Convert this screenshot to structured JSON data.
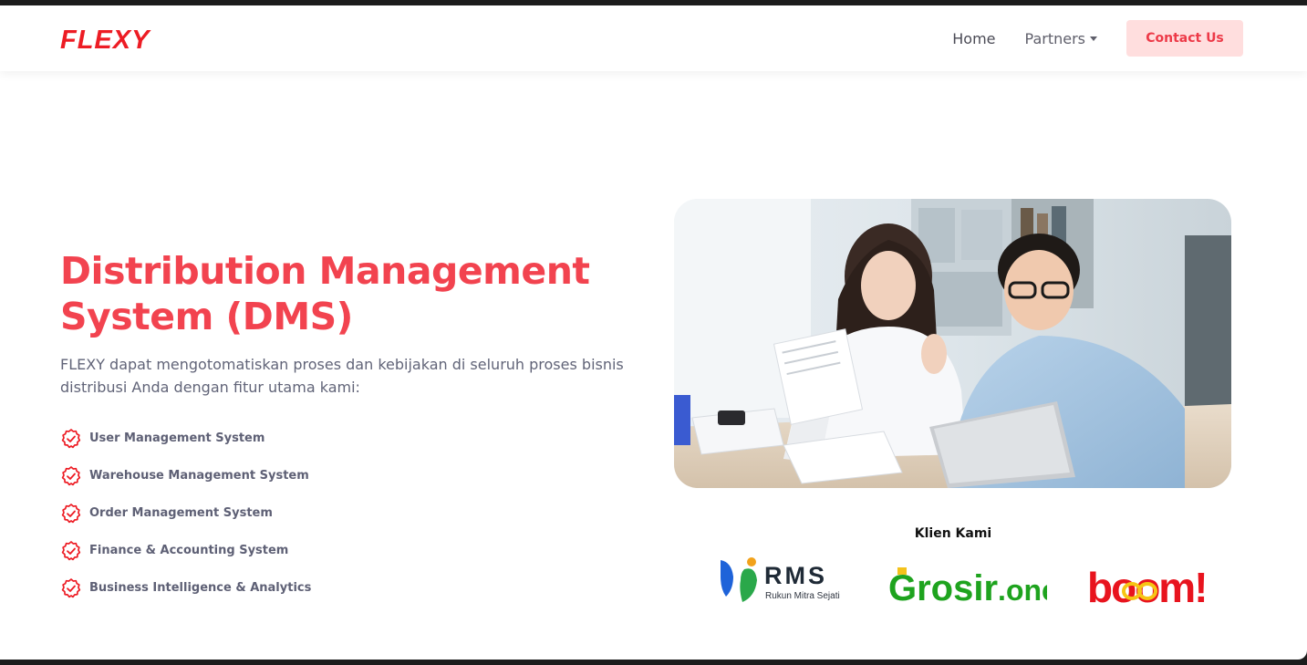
{
  "brand": {
    "logo_text": "FLEXY",
    "accent": "#ED1C24"
  },
  "nav": {
    "home": "Home",
    "partners": "Partners",
    "contact": "Contact Us"
  },
  "hero": {
    "title": "Distribution Management System (DMS)",
    "description": "FLEXY dapat mengotomatiskan proses dan kebijakan di seluruh proses bisnis distribusi Anda dengan fitur utama kami:",
    "features": [
      "User Management System",
      "Warehouse Management System",
      "Order Management System",
      "Finance & Accounting System",
      "Business Intelligence & Analytics"
    ],
    "title_color": "#F2434F"
  },
  "clients": {
    "title": "Klien Kami",
    "rms": {
      "name": "RMS",
      "tagline": "Rukun Mitra Sejati"
    },
    "grosir": {
      "name": "Grosir",
      "suffix": ".one"
    },
    "boom": {
      "name": "boom!"
    }
  }
}
